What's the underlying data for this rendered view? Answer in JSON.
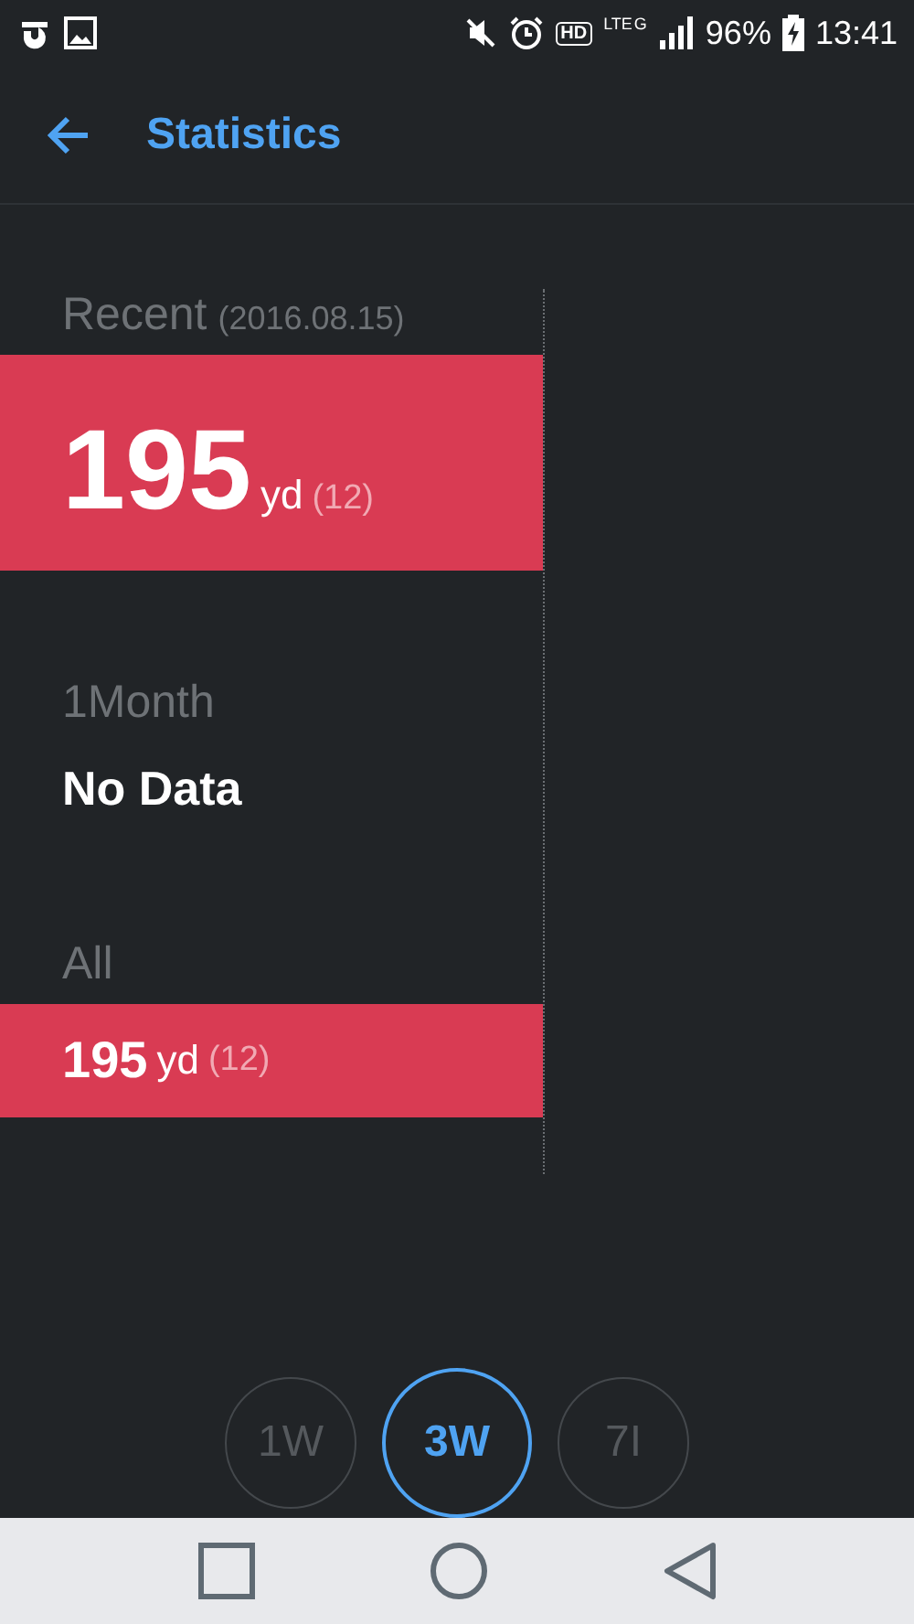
{
  "status_bar": {
    "hd": "HD",
    "network": "LTE",
    "network_gen": "G",
    "battery": "96%",
    "time": "13:41"
  },
  "header": {
    "title": "Statistics"
  },
  "sections": [
    {
      "kind": "hero",
      "label": "Recent",
      "date": "(2016.08.15)",
      "value": "195",
      "unit": "yd",
      "count": "(12)"
    },
    {
      "kind": "empty",
      "label": "1Month",
      "text": "No Data"
    },
    {
      "kind": "band",
      "label": "All",
      "value": "195",
      "unit": "yd",
      "count": "(12)"
    }
  ],
  "periods": [
    {
      "label": "1W",
      "selected": false
    },
    {
      "label": "3W",
      "selected": true
    },
    {
      "label": "7I",
      "selected": false
    }
  ]
}
